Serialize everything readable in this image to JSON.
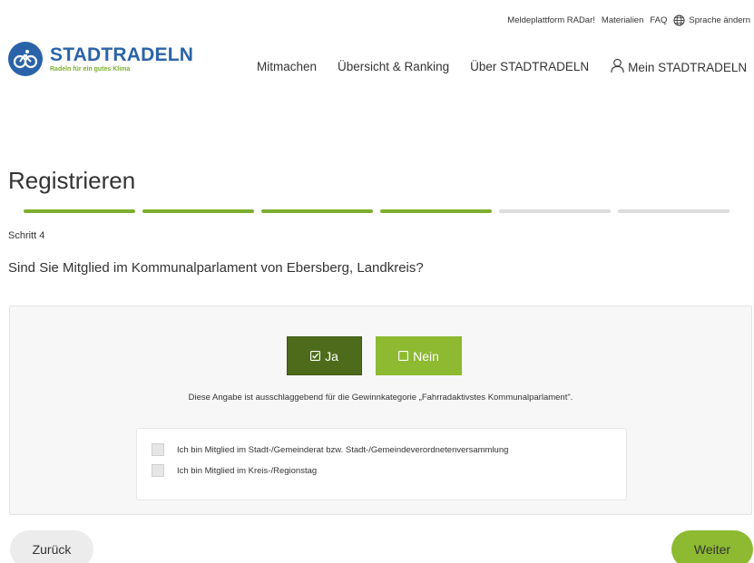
{
  "topbar": {
    "links": [
      "Meldeplattform RADar!",
      "Materialien",
      "FAQ"
    ],
    "language_label": "Sprache ändern",
    "language_icon": "globe-icon"
  },
  "brand": {
    "title": "STADTRADELN",
    "subtitle": "Radeln für ein gutes Klima",
    "logo_icon": "cyclist-icon",
    "primary_color": "#2a63a8",
    "accent_color": "#8dba31"
  },
  "nav": {
    "items": [
      "Mitmachen",
      "Übersicht & Ranking",
      "Über STADTRADELN"
    ],
    "account_label": "Mein STADTRADELN",
    "account_icon": "user-icon"
  },
  "page": {
    "title": "Registrieren",
    "progress": {
      "total_steps": 6,
      "completed_steps": 4
    },
    "step_label": "Schritt 4",
    "question": "Sind Sie Mitglied im Kommunalparlament von Ebersberg, Landkreis?"
  },
  "choice": {
    "yes_label": "Ja",
    "no_label": "Nein",
    "selected": "Ja",
    "hint": "Diese Angabe ist ausschlaggebend für die Gewinnkategorie „Fahrradaktivstes Kommunalparlament\"."
  },
  "options": [
    "Ich bin Mitglied im Stadt-/Gemeinderat bzw. Stadt-/Gemeindeverordnetenversammlung",
    "Ich bin Mitglied im Kreis-/Regionstag"
  ],
  "footer": {
    "back_label": "Zurück",
    "next_label": "Weiter"
  }
}
